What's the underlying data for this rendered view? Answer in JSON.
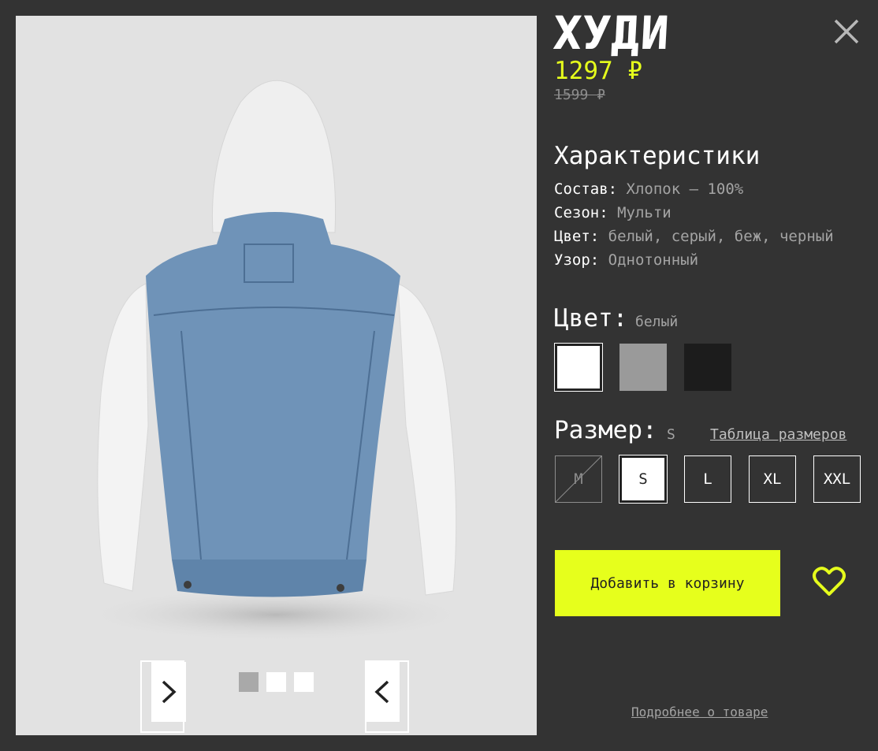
{
  "product": {
    "title": "ХУДИ",
    "price": "1297 ₽",
    "old_price": "1599 ₽"
  },
  "specs": {
    "heading": "Характеристики",
    "rows": [
      {
        "key": "Состав:",
        "value": "Хлопок — 100%"
      },
      {
        "key": "Сезон:",
        "value": "Мульти"
      },
      {
        "key": "Цвет:",
        "value": "белый, серый, беж, черный"
      },
      {
        "key": "Узор:",
        "value": "Однотонный"
      }
    ]
  },
  "color_picker": {
    "label": "Цвет:",
    "selected": "белый",
    "swatches": [
      {
        "name": "белый",
        "hex": "#ffffff"
      },
      {
        "name": "серый",
        "hex": "#9a9a9a"
      },
      {
        "name": "черный",
        "hex": "#1c1c1c"
      }
    ]
  },
  "size_picker": {
    "label": "Размер:",
    "selected": "S",
    "table_link": "Таблица размеров",
    "sizes": [
      {
        "label": "M",
        "available": false
      },
      {
        "label": "S",
        "available": true
      },
      {
        "label": "L",
        "available": true
      },
      {
        "label": "XL",
        "available": true
      },
      {
        "label": "XXL",
        "available": true
      }
    ]
  },
  "actions": {
    "add_to_cart": "Добавить в корзину",
    "more_link": "Подробнее о товаре"
  },
  "gallery": {
    "slide_count": 3,
    "active_slide": 1
  },
  "colors": {
    "background": "#333333",
    "accent": "#e6ff1c",
    "muted": "#a4a4a4"
  }
}
